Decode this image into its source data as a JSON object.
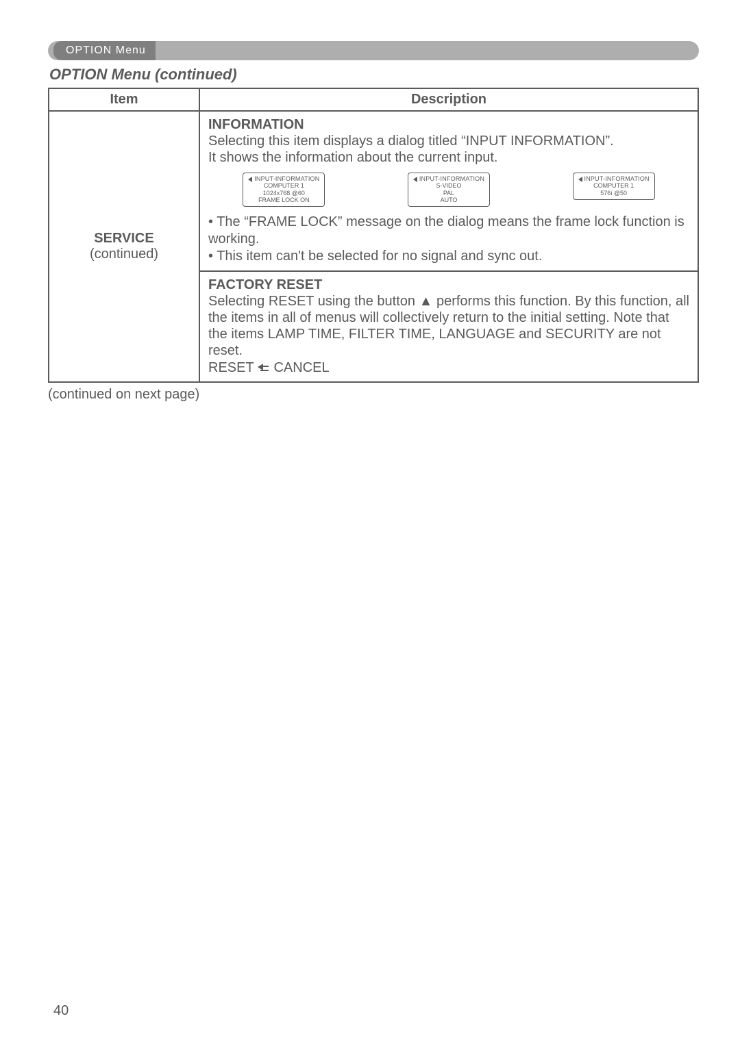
{
  "menuBar": {
    "label": "OPTION Menu"
  },
  "sectionTitle": "OPTION Menu (continued)",
  "table": {
    "headers": {
      "item": "Item",
      "description": "Description"
    },
    "row": {
      "item": {
        "name": "SERVICE",
        "sub": "(continued)"
      },
      "information": {
        "heading": "INFORMATION",
        "line1": "Selecting this item displays a dialog titled “INPUT INFORMATION”.",
        "line2": "It shows the information about the current input.",
        "boxes": [
          {
            "title": "INPUT-INFORMATION",
            "l1": "COMPUTER 1",
            "l2": "1024x768 @60",
            "l3": "FRAME LOCK ON"
          },
          {
            "title": "INPUT-INFORMATION",
            "l1": "S-VIDEO",
            "l2": "PAL",
            "l3": "AUTO"
          },
          {
            "title": "INPUT-INFORMATION",
            "l1": "COMPUTER 1",
            "l2": "576i @50",
            "l3": ""
          }
        ],
        "bullet1": "• The “FRAME LOCK” message on the dialog means the frame lock function is working.",
        "bullet2": "• This item can't be selected for no signal and sync out."
      },
      "factoryReset": {
        "heading": "FACTORY RESET",
        "body": "Selecting RESET using the button ▲ performs this function. By this function, all the items in all of menus will collectively return to the initial setting. Note that the items LAMP TIME, FILTER TIME, LANGUAGE and SECURITY are not reset.",
        "resetLeft": "RESET",
        "resetRight": "CANCEL"
      }
    }
  },
  "continuedNote": "(continued on next page)",
  "pageNumber": "40"
}
